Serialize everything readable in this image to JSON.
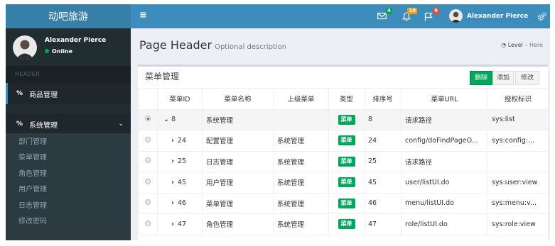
{
  "app": {
    "logo_text": "动吧旅游"
  },
  "navbar": {
    "toggle_icon": "hamburger-icon",
    "messages_count": "4",
    "notifications_count": "10",
    "tasks_count": "9",
    "user_name": "Alexander Pierce",
    "colors": {
      "bar": "#3c8dbc",
      "logo": "#367fa9",
      "badge_green": "#00a65a",
      "badge_yellow": "#f39c12",
      "badge_red": "#dd4b39"
    }
  },
  "sidebar": {
    "user_name": "Alexander Pierce",
    "status": "Online",
    "header": "HEADER",
    "items": [
      {
        "label": "商品管理",
        "icon": "link-icon"
      },
      {
        "label": "系统管理",
        "icon": "link-icon"
      }
    ],
    "submenu": [
      "部门管理",
      "菜单管理",
      "角色管理",
      "用户管理",
      "日志管理",
      "修改密码"
    ]
  },
  "page": {
    "title": "Page Header",
    "description": "Optional description",
    "breadcrumb": {
      "level": "Level",
      "here": "Here"
    }
  },
  "box": {
    "title": "菜单管理",
    "buttons": {
      "delete": "删除",
      "add": "添加",
      "edit": "修改"
    }
  },
  "table": {
    "headers": [
      "",
      "菜单ID",
      "菜单名称",
      "上级菜单",
      "类型",
      "排序号",
      "菜单URL",
      "授权标识"
    ],
    "rows": [
      {
        "selected": true,
        "id": "8",
        "name": "系统管理",
        "parent": "",
        "type": "菜单",
        "sort": "8",
        "url": "请求路径",
        "perm": "sys:list"
      },
      {
        "selected": false,
        "id": "24",
        "name": "配置管理",
        "parent": "系统管理",
        "type": "菜单",
        "sort": "24",
        "url": "config/doFindPageO...",
        "perm": "sys:config:..."
      },
      {
        "selected": false,
        "id": "25",
        "name": "日志管理",
        "parent": "系统管理",
        "type": "菜单",
        "sort": "25",
        "url": "请求路径",
        "perm": ""
      },
      {
        "selected": false,
        "id": "45",
        "name": "用户管理",
        "parent": "系统管理",
        "type": "菜单",
        "sort": "45",
        "url": "user/listUI.do",
        "perm": "sys:user:view"
      },
      {
        "selected": false,
        "id": "46",
        "name": "菜单管理",
        "parent": "系统管理",
        "type": "菜单",
        "sort": "46",
        "url": "menu/listUI.do",
        "perm": "sys:menu:v..."
      },
      {
        "selected": false,
        "id": "47",
        "name": "角色管理",
        "parent": "系统管理",
        "type": "菜单",
        "sort": "47",
        "url": "role/listUI.do",
        "perm": "sys:role:view"
      }
    ]
  }
}
